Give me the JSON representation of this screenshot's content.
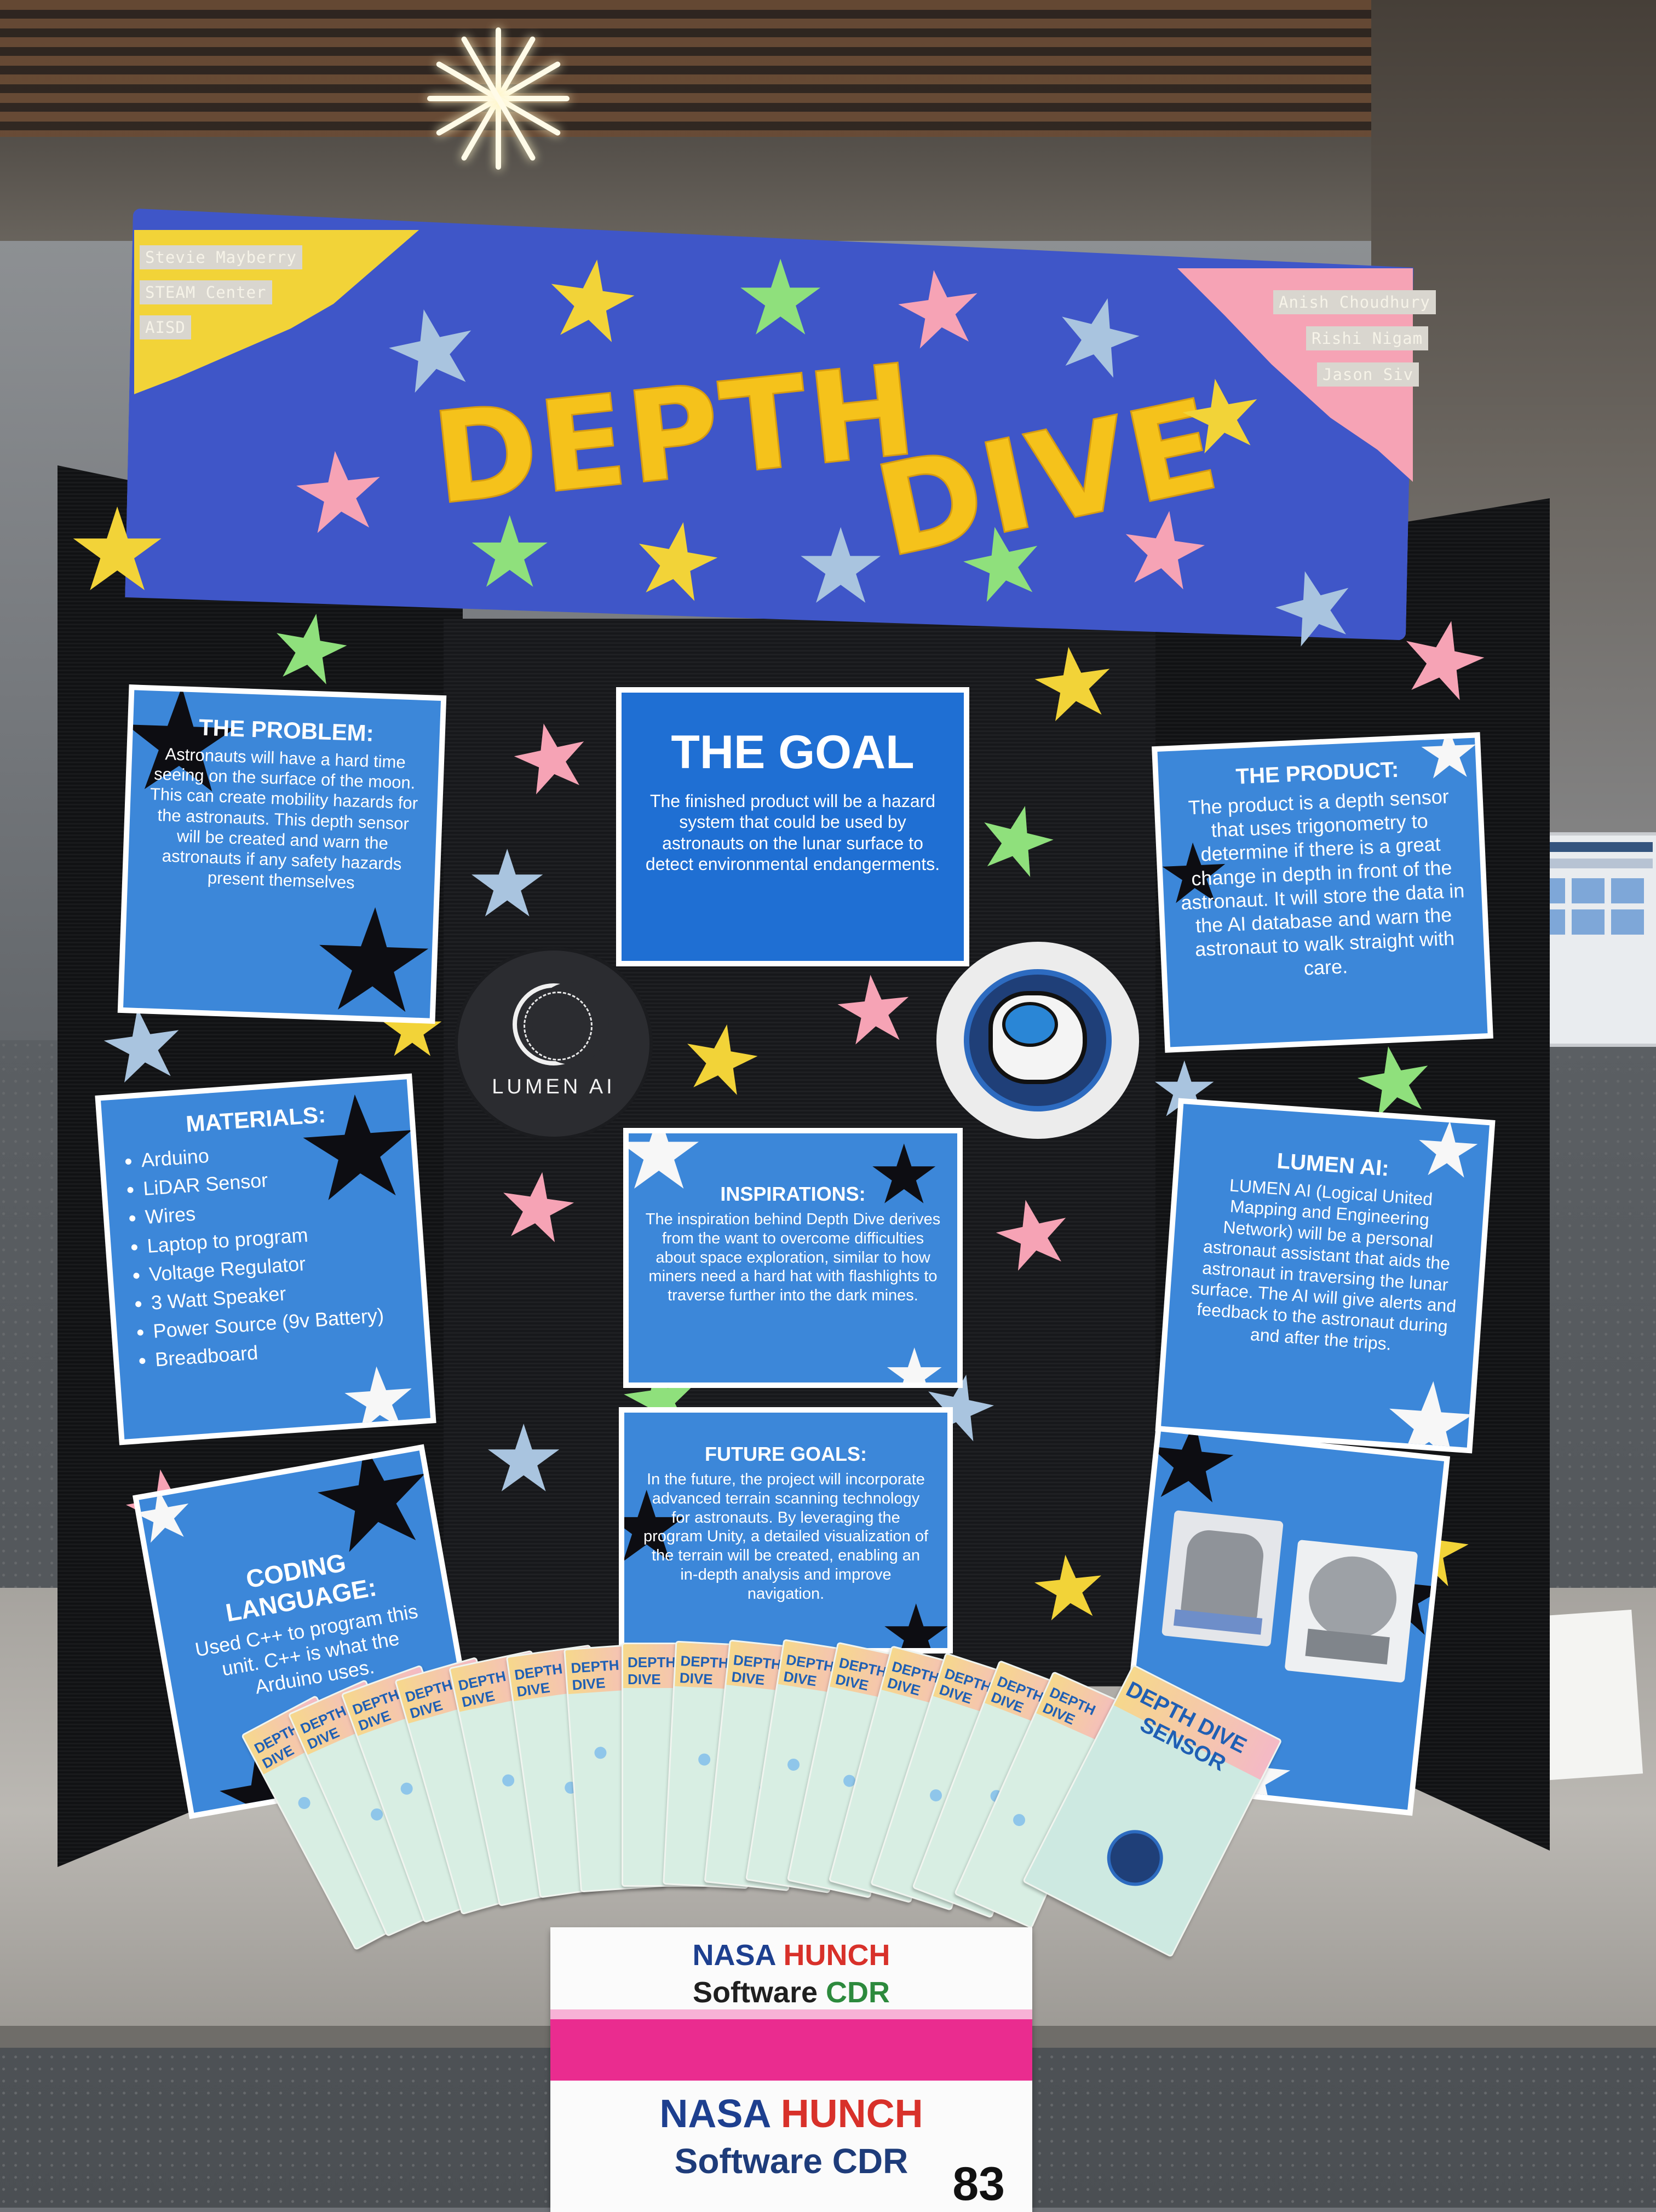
{
  "header": {
    "title_depth": "DEPTH",
    "title_dive": "DIVE",
    "left_names": [
      "Stevie Mayberry",
      "STEAM Center",
      "AISD"
    ],
    "right_names": [
      "Anish Choudhury",
      "Rishi Nigam",
      "Jason Siv"
    ]
  },
  "cards": {
    "problem": {
      "heading": "THE PROBLEM:",
      "body": "Astronauts will have a hard time seeing on the surface of the moon. This can create mobility hazards for the astronauts. This depth sensor will be created and warn the astronauts if any safety hazards present themselves"
    },
    "materials": {
      "heading": "MATERIALS:",
      "items": [
        "Arduino",
        "LiDAR Sensor",
        "Wires",
        "Laptop to program",
        "Voltage Regulator",
        "3 Watt Speaker",
        "Power Source (9v Battery)",
        "Breadboard"
      ]
    },
    "coding": {
      "heading": "CODING LANGUAGE:",
      "body": "Used C++ to program this unit. C++ is what the Arduino uses."
    },
    "goal": {
      "heading": "THE GOAL",
      "body": "The finished product will be a hazard system that could be used by astronauts on the lunar surface to detect environmental endangerments."
    },
    "inspirations": {
      "heading": "INSPIRATIONS:",
      "body": "The inspiration behind Depth Dive derives from the want to overcome difficulties about space exploration, similar to how miners need a hard hat with flashlights to traverse further into the dark mines."
    },
    "future": {
      "heading": "FUTURE GOALS:",
      "body": "In the future, the project will incorporate advanced terrain scanning technology for astronauts. By leveraging the program Unity, a detailed visualization of the terrain will be created, enabling an in-depth analysis and improve navigation."
    },
    "product": {
      "heading": "THE PRODUCT:",
      "body": "The product is a depth sensor that uses trigonometry to determine if there is a great change in depth in front of the astronaut. It will store the data in the AI database and warn the astronaut to walk straight with care."
    },
    "lumen_ai": {
      "heading": "LUMEN AI:",
      "body": "LUMEN AI (Logical United Mapping and Engineering Network) will be a personal astronaut assistant that aids the astronaut in traversing the lunar surface. The AI will give alerts and feedback to the astronaut during and after the trips."
    }
  },
  "logos": {
    "lumen_label": "LUMEN AI"
  },
  "pamphlet": {
    "title": "DEPTH DIVE",
    "subtitle": "SENSOR"
  },
  "sign": {
    "upper_nasa": "NASA",
    "upper_hunch": "HUNCH",
    "upper_software": "Software",
    "upper_cdr": "CDR",
    "lower_nasa": "NASA",
    "lower_hunch": "HUNCH",
    "lower_line2": "Software CDR",
    "number": "83"
  },
  "colors": {
    "header_blue": "#3f56c8",
    "card_blue": "#3c87d9",
    "title_yellow": "#f5c21b",
    "board_black": "#111214"
  }
}
